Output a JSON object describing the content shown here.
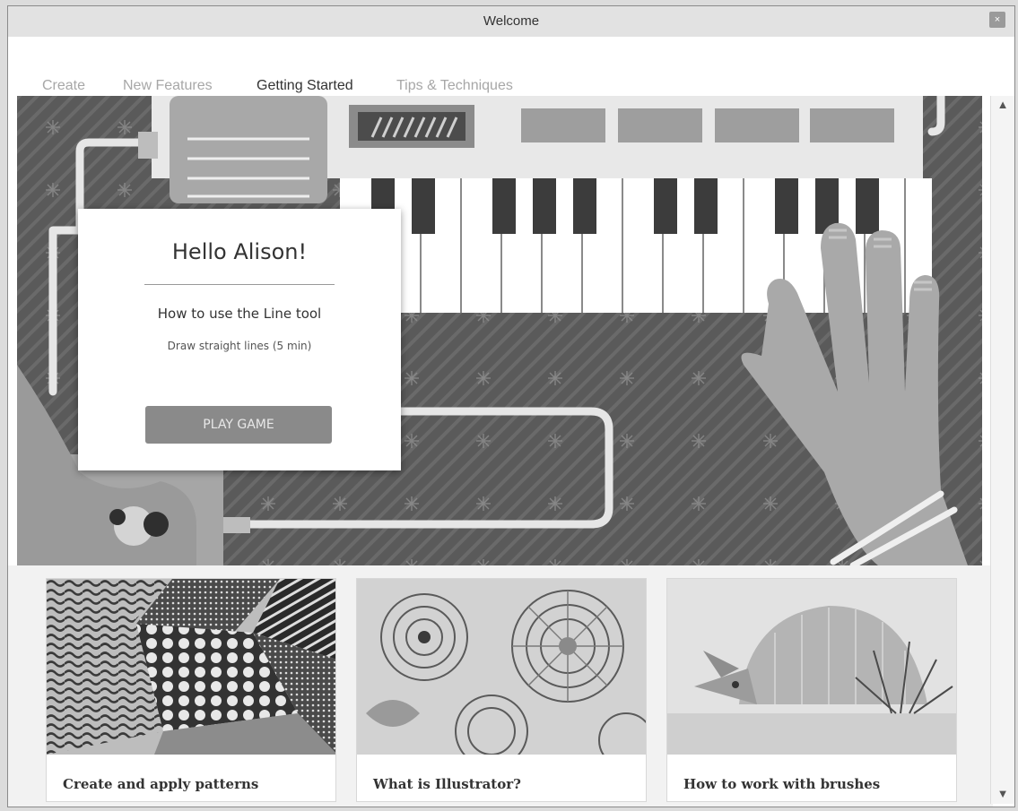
{
  "window": {
    "title": "Welcome",
    "close_icon": "×"
  },
  "tabs": [
    {
      "label": "Create",
      "active": false
    },
    {
      "label": "New Features",
      "active": false
    },
    {
      "label": "Getting Started",
      "active": true
    },
    {
      "label": "Tips & Techniques",
      "active": false
    }
  ],
  "hero_card": {
    "title": "Hello Alison!",
    "subtitle": "How to use the Line tool",
    "description": "Draw straight lines (5 min)",
    "button_label": "PLAY GAME"
  },
  "tiles": [
    {
      "label": "Create and apply patterns"
    },
    {
      "label": "What is Illustrator?"
    },
    {
      "label": "How to work with brushes"
    }
  ],
  "scrollbar": {
    "up_icon": "▲",
    "down_icon": "▼"
  }
}
